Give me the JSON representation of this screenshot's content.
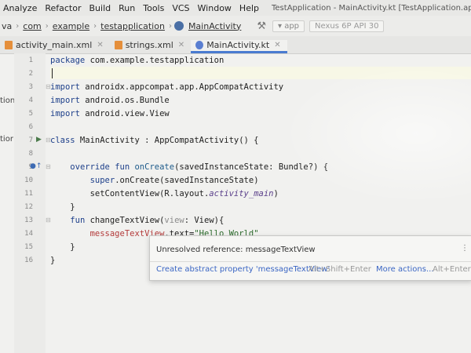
{
  "menubar": {
    "items": [
      "Analyze",
      "Refactor",
      "Build",
      "Run",
      "Tools",
      "VCS",
      "Window",
      "Help"
    ],
    "window_title": "TestApplication - MainActivity.kt [TestApplication.app] - Android Studio"
  },
  "breadcrumb": {
    "items": [
      "va",
      "com",
      "example",
      "testapplication",
      "MainActivity"
    ]
  },
  "toolbar": {
    "run_config": "app",
    "device": "Nexus 6P API 30"
  },
  "tabs": [
    {
      "label": "activity_main.xml",
      "icon": "xml-file-icon",
      "active": false
    },
    {
      "label": "strings.xml",
      "icon": "xml-file-icon",
      "active": false
    },
    {
      "label": "MainActivity.kt",
      "icon": "kotlin-file-icon",
      "active": true
    }
  ],
  "side_labels": [
    "tion",
    "tior"
  ],
  "editor": {
    "line_numbers": [
      "1",
      "2",
      "3",
      "4",
      "5",
      "6",
      "7",
      "8",
      "9",
      "10",
      "11",
      "12",
      "13",
      "14",
      "15",
      "16"
    ],
    "code": {
      "l1_kw": "package",
      "l1_rest": " com.example.testapplication",
      "l3_kw": "import",
      "l3_rest": " androidx.appcompat.app.AppCompatActivity",
      "l4_kw": "import",
      "l4_rest": " android.os.Bundle",
      "l5_kw": "import",
      "l5_rest": " android.view.View",
      "l7_kw": "class",
      "l7_rest": " MainActivity : AppCompatActivity() {",
      "l9_kw": "override fun",
      "l9_fn": " onCreate",
      "l9_rest": "(savedInstanceState: Bundle?) {",
      "l10_kw": "super",
      "l10_rest": ".onCreate(savedInstanceState)",
      "l11_a": "setContentView(R.layout.",
      "l11_it": "activity_main",
      "l11_b": ")",
      "l12": "}",
      "l13_kw": "fun",
      "l13_fn": " changeTextView(",
      "l13_param": "view",
      "l13_rest": ": View){",
      "l14_err": "messageTextView",
      "l14_dot": ".",
      "l14_prop": "text",
      "l14_eq": "=",
      "l14_str": "\"Hello World\"",
      "l15": "}",
      "l16": "}"
    }
  },
  "popup": {
    "message": "Unresolved reference: messageTextView",
    "fix_label": "Create abstract property 'messageTextView'",
    "fix_shortcut": "Alt+Shift+Enter",
    "more_label": "More actions...",
    "more_shortcut": "Alt+Enter"
  }
}
